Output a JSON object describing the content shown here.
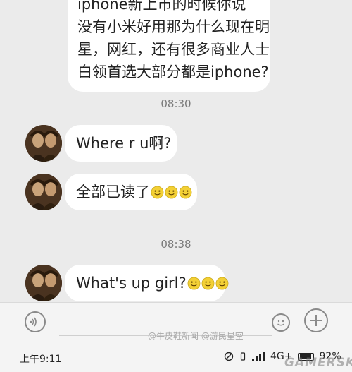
{
  "messages": {
    "first": {
      "lines": [
        "iphone新上市的时候你说",
        "没有小米好用那为什么现在明",
        "星，网红，还有很多商业人士",
        "白领首选大部分都是iphone?"
      ]
    },
    "time_1": "08:30",
    "msg_1": "Where r u啊?",
    "msg_2": "全部已读了",
    "time_2": "08:38",
    "msg_3": "What's up girl?"
  },
  "input": {
    "placeholder": ""
  },
  "watermark": "@牛皮鞋新闻  @游民星空",
  "status_bar": {
    "time": "上午9:11",
    "signal": "4G+",
    "battery": "92%",
    "battery_level": 0.92
  },
  "brand": "GAMERSKY",
  "colors": {
    "bubble": "#ffffff",
    "background": "#ebebeb",
    "emoji": "#f3d035"
  }
}
